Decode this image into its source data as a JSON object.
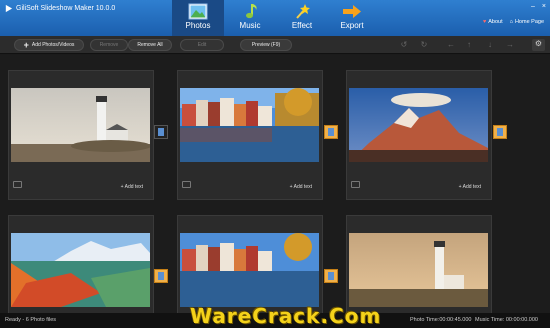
{
  "window": {
    "title": "GiliSoft Slideshow Maker 10.0.0"
  },
  "tabs": [
    {
      "label": "Photos",
      "icon": "image-icon",
      "active": true
    },
    {
      "label": "Music",
      "icon": "music-note-icon",
      "active": false
    },
    {
      "label": "Effect",
      "icon": "magic-wand-icon",
      "active": false
    },
    {
      "label": "Export",
      "icon": "arrow-right-icon",
      "active": false
    }
  ],
  "header_links": {
    "about": "About",
    "home": "Home Page"
  },
  "toolbar": {
    "add": "Add Photos/Videos",
    "remove": "Remove",
    "remove_all": "Remove All",
    "edit": "Edit",
    "preview": "Preview (F9)"
  },
  "cards": [
    {
      "add_text": "+ Add text"
    },
    {
      "add_text": "+ Add text"
    },
    {
      "add_text": "+ Add text"
    },
    {
      "add_text": ""
    },
    {
      "add_text": ""
    },
    {
      "add_text": ""
    }
  ],
  "status": {
    "left": "Ready - 6 Photo files",
    "photo_time": "Photo Time:00:00:45.000",
    "music_time": "Music Time: 00:00:00.000"
  },
  "watermark": "WareCrack.Com",
  "colors": {
    "accent": "#1b5fae",
    "transition": "#f0b04a",
    "watermark": "#f4d21a"
  }
}
